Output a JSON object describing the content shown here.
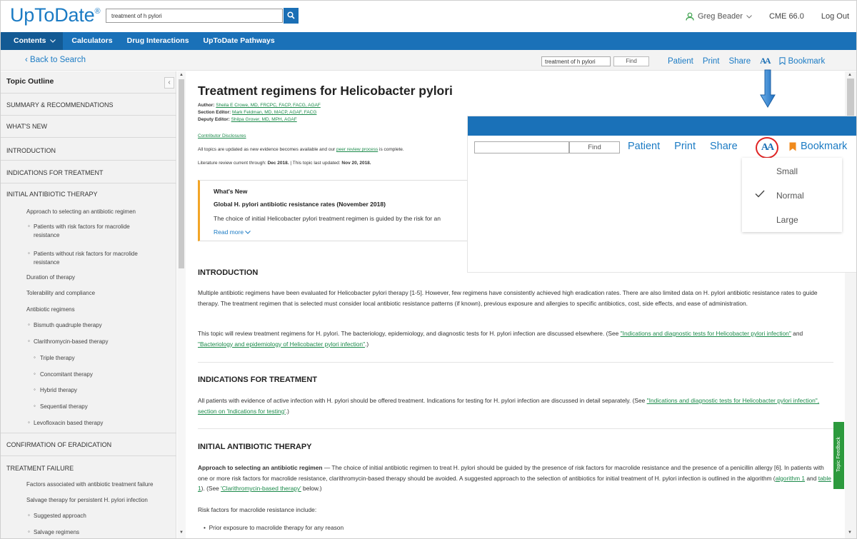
{
  "header": {
    "logo": "UpToDate",
    "logo_mark": "®",
    "search_value": "treatment of h pylori",
    "user_name": "Greg Beader",
    "cme": "CME 66.0",
    "logout": "Log Out"
  },
  "nav": {
    "items": [
      "Contents",
      "Calculators",
      "Drug Interactions",
      "UpToDate Pathways"
    ]
  },
  "subbar": {
    "back": "Back to Search",
    "find_value": "treatment of h pylori",
    "find_button": "Find",
    "patient": "Patient",
    "print": "Print",
    "share": "Share",
    "font_size": "AA",
    "bookmark": "Bookmark"
  },
  "sidebar": {
    "title": "Topic Outline",
    "sections": [
      "SUMMARY & RECOMMENDATIONS",
      "WHAT'S NEW",
      "INTRODUCTION",
      "INDICATIONS FOR TREATMENT",
      "INITIAL ANTIBIOTIC THERAPY",
      "CONFIRMATION OF ERADICATION",
      "TREATMENT FAILURE"
    ],
    "initial_items": [
      "Approach to selecting an antibiotic regimen",
      "Patients with risk factors for macrolide",
      "resistance",
      "Patients without risk factors for macrolide",
      "resistance",
      "Duration of therapy",
      "Tolerability and compliance",
      "Antibiotic regimens",
      "Bismuth quadruple therapy",
      "Clarithromycin-based therapy",
      "Triple therapy",
      "Concomitant therapy",
      "Hybrid therapy",
      "Sequential therapy",
      "Levofloxacin based therapy"
    ],
    "failure_items": [
      "Factors associated with antibiotic treatment failure",
      "Salvage therapy for persistent H. pylori infection",
      "Suggested approach",
      "Salvage regimens"
    ]
  },
  "article": {
    "title": "Treatment regimens for Helicobacter pylori",
    "author_label": "Author:",
    "author": "Sheila E Crowe, MD, FRCPC, FACP, FACG, AGAF",
    "section_editor_label": "Section Editor:",
    "section_editor": "Mark Feldman, MD, MACP, AGAF, FACG",
    "deputy_editor_label": "Deputy Editor:",
    "deputy_editor": "Shilpa Grover, MD, MPH, AGAF",
    "disclosures": "Contributor Disclosures",
    "update_note_pre": "All topics are updated as new evidence becomes available and our ",
    "update_note_link": "peer review process",
    "update_note_post": " is complete.",
    "lit_review_pre": "Literature review current through: ",
    "lit_review_date": "Dec 2018.",
    "lit_review_mid": " | This topic last updated: ",
    "lit_review_updated": "Nov 20, 2018.",
    "whats_new": {
      "heading": "What's New",
      "title": "Global H. pylori antibiotic resistance rates (November 2018)",
      "text": "The choice of initial Helicobacter pylori treatment regimen is guided by the risk for an",
      "more": "Read more"
    },
    "intro_heading": "INTRODUCTION",
    "intro_p1": "Multiple antibiotic regimens have been evaluated for Helicobacter pylori therapy [1-5]. However, few regimens have consistently achieved high eradication rates. There are also limited data on H. pylori antibiotic resistance rates to guide therapy. The treatment regimen that is selected must consider local antibiotic resistance patterns (if known), previous exposure and allergies to specific antibiotics, cost, side effects, and ease of administration.",
    "intro_p2_pre": "This topic will review treatment regimens for H. pylori. The bacteriology, epidemiology, and diagnostic tests for H. pylori infection are discussed elsewhere. (See ",
    "intro_p2_link1": "\"Indications and diagnostic tests for Helicobacter pylori infection\"",
    "intro_p2_mid": " and ",
    "intro_p2_link2": "\"Bacteriology and epidemiology of Helicobacter pylori infection\"",
    "intro_p2_post": ".)",
    "ind_heading": "INDICATIONS FOR TREATMENT",
    "ind_p_pre": "All patients with evidence of active infection with H. pylori should be offered treatment. Indications for testing for H. pylori infection are discussed in detail separately. (See ",
    "ind_p_link": "\"Indications and diagnostic tests for Helicobacter pylori infection\", section on 'Indications for testing'",
    "ind_p_post": ".)",
    "iat_heading": "INITIAL ANTIBIOTIC THERAPY",
    "iat_bold": "Approach to selecting an antibiotic regimen",
    "iat_p": " — The choice of initial antibiotic regimen to treat H. pylori should be guided by the presence of risk factors for macrolide resistance and the presence of a penicillin allergy [6]. In patients with one or more risk factors for macrolide resistance, clarithromycin-based therapy should be avoided. A suggested approach to the selection of antibiotics for initial treatment of H. pylori infection is outlined in the algorithm (",
    "iat_link1": "algorithm 1",
    "iat_and": " and ",
    "iat_link2": "table 1",
    "iat_see": "). (See ",
    "iat_link3": "'Clarithromycin-based therapy'",
    "iat_below": " below.)",
    "risk_intro": "Risk factors for macrolide resistance include:",
    "risk_1": "Prior exposure to macrolide therapy for any reason"
  },
  "overlay": {
    "find_button": "Find",
    "patient": "Patient",
    "print": "Print",
    "share": "Share",
    "font_size": "AA",
    "bookmark": "Bookmark",
    "options": [
      "Small",
      "Normal",
      "Large"
    ],
    "selected": "Normal"
  },
  "feedback": "Topic Feedback",
  "colors": {
    "brand_blue": "#1a71b8",
    "link_green": "#1b8a4a",
    "accent_orange": "#f2a526",
    "highlight_red": "#e02424"
  }
}
